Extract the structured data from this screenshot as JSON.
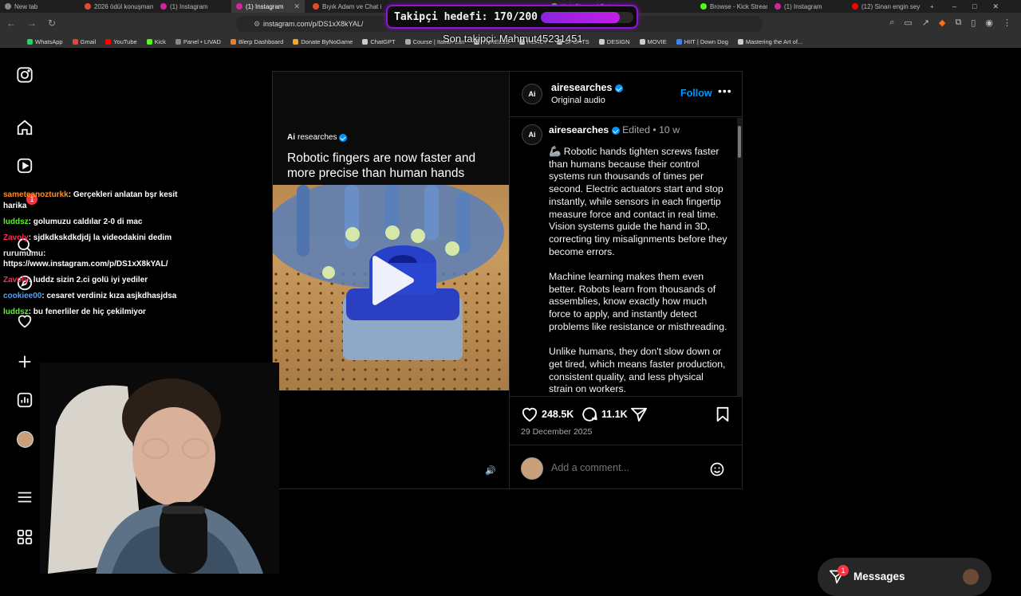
{
  "browser": {
    "tabs": [
      {
        "title": "New tab",
        "color": "#888888",
        "active": false
      },
      {
        "title": "2026 ödül konuşmam",
        "color": "#e34b2a",
        "active": false
      },
      {
        "title": "(1) Instagram",
        "color": "#d6249f",
        "active": false
      },
      {
        "title": "(1) Instagram",
        "color": "#d6249f",
        "active": true
      },
      {
        "title": "Bıyık Adam ve Chat i",
        "color": "#e34b2a",
        "active": false
      },
      {
        "title": "Kick Channel Points |",
        "color": "#53fc18",
        "active": false
      },
      {
        "title": "Browse - Kick Stream",
        "color": "#53fc18",
        "active": false
      },
      {
        "title": "(1) Instagram",
        "color": "#d6249f",
        "active": false
      },
      {
        "title": "(12) Sinan engin sey",
        "color": "#ff0000",
        "active": false
      }
    ],
    "url": "instagram.com/p/DS1xX8kYAL/",
    "bookmarks": [
      {
        "label": "WhatsApp",
        "color": "#25d366"
      },
      {
        "label": "Gmail",
        "color": "#ea4335"
      },
      {
        "label": "YouTube",
        "color": "#ff0000"
      },
      {
        "label": "Kick",
        "color": "#53fc18"
      },
      {
        "label": "Panel • LIVAD",
        "color": "#888888"
      },
      {
        "label": "Blerp Dashboard",
        "color": "#f47a22"
      },
      {
        "label": "Donate ByNoGame",
        "color": "#f5a623"
      },
      {
        "label": "ChatGPT",
        "color": "#cccccc"
      },
      {
        "label": "Course | Italian Lan",
        "color": "#aaaaaa"
      },
      {
        "label": "THREEJS",
        "color": "#cccccc"
      },
      {
        "label": "REACT",
        "color": "#cccccc"
      },
      {
        "label": "SPORTS",
        "color": "#cccccc"
      },
      {
        "label": "DESIGN",
        "color": "#cccccc"
      },
      {
        "label": "MOVIE",
        "color": "#cccccc"
      },
      {
        "label": "HIIT | Down Dog",
        "color": "#3b82f6"
      },
      {
        "label": "Mastering the Art of...",
        "color": "#cccccc"
      }
    ]
  },
  "post": {
    "username": "airesearches",
    "audio": "Original audio",
    "follow": "Follow",
    "edited": "Edited",
    "age": "10 w",
    "media_brand": "researches",
    "media_headline": "Robotic fingers are now faster and more precise than human hands",
    "caption": [
      "🦾 Robotic hands tighten screws faster than humans because their control systems run thousands of times per second. Electric actuators start and stop instantly, while sensors in each fingertip measure force and contact in real time. Vision systems guide the hand in 3D, correcting tiny misalignments before they become errors.",
      "Machine learning makes them even better. Robots learn from thousands of assemblies, know exactly how much force to apply, and instantly detect problems like resistance or misthreading.",
      "Unlike humans, they don't slow down or get tired, which means faster production, consistent quality, and less physical strain on workers."
    ],
    "likes": "248.5K",
    "comments": "11.1K",
    "date": "29 December 2025",
    "comment_placeholder": "Add a comment..."
  },
  "chat": [
    {
      "user": "sameteanozturkk",
      "text": "Gerçekleri anlatan bşr kesit harika",
      "color": "#ff8c2a"
    },
    {
      "user": "luddsz",
      "text": "golumuzu caldılar 2-0 di mac",
      "color": "#53fc18"
    },
    {
      "user": "Zavoly",
      "text": "sjdkdkskdkdjdj la videodakini dedim",
      "color": "#ff2d55"
    },
    {
      "user": "rurumumu",
      "text": "https://www.instagram.com/p/DS1xX8kYAL/",
      "color": "#e8e8e8"
    },
    {
      "user": "Zavoly",
      "text": "luddz sizin 2.ci golü iyi yediler",
      "color": "#ff2d55"
    },
    {
      "user": "cookiee00",
      "text": "cesaret verdiniz kıza asjkdhasjdsa",
      "color": "#4aa3ff"
    },
    {
      "user": "luddsz",
      "text": "bu fenerliler de hiç çekilmiyor",
      "color": "#53fc18"
    }
  ],
  "overlay": {
    "goal_text": "Takipçi hedefi: 170/200",
    "goal_progress": 0.85,
    "last_follower": "Son takipçi: Mahmut45231451"
  },
  "messages": {
    "label": "Messages",
    "badge": "1"
  },
  "nav_badge": "1"
}
